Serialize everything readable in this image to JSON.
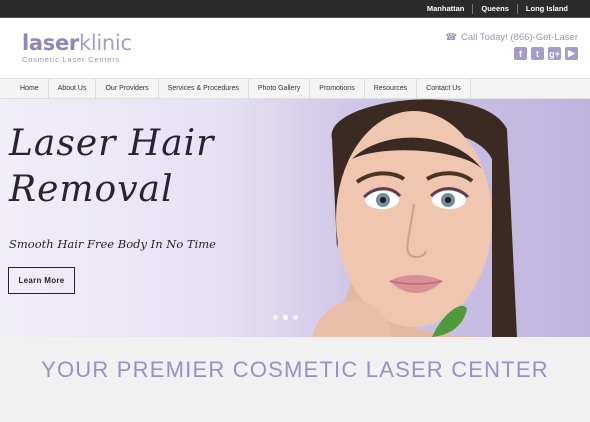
{
  "topbar": {
    "locations": [
      "Manhattan",
      "Queens",
      "Long Island"
    ]
  },
  "brand": {
    "name_bold": "laser",
    "name_light": "klinic",
    "tagline": "Cosmetic Laser Centers"
  },
  "contact": {
    "call_label": "Call Today! (866)-Get-Laser"
  },
  "social": [
    {
      "icon": "facebook-icon",
      "glyph": "f"
    },
    {
      "icon": "twitter-icon",
      "glyph": "t"
    },
    {
      "icon": "google-plus-icon",
      "glyph": "g+"
    },
    {
      "icon": "youtube-icon",
      "glyph": "▶"
    }
  ],
  "nav": [
    "Home",
    "About Us",
    "Our Providers",
    "Services & Procedures",
    "Photo Gallery",
    "Promotions",
    "Resources",
    "Contact Us"
  ],
  "hero": {
    "title_line1": "Laser Hair",
    "title_line2": "Removal",
    "subtitle": "Smooth Hair Free Body In No Time",
    "cta": "Learn More",
    "slide_count": 3,
    "active_slide": 1
  },
  "section": {
    "headline": "YOUR PREMIER COSMETIC LASER CENTER"
  },
  "colors": {
    "brand_purple": "#9a8fc9",
    "topbar": "#2b2b2b"
  }
}
